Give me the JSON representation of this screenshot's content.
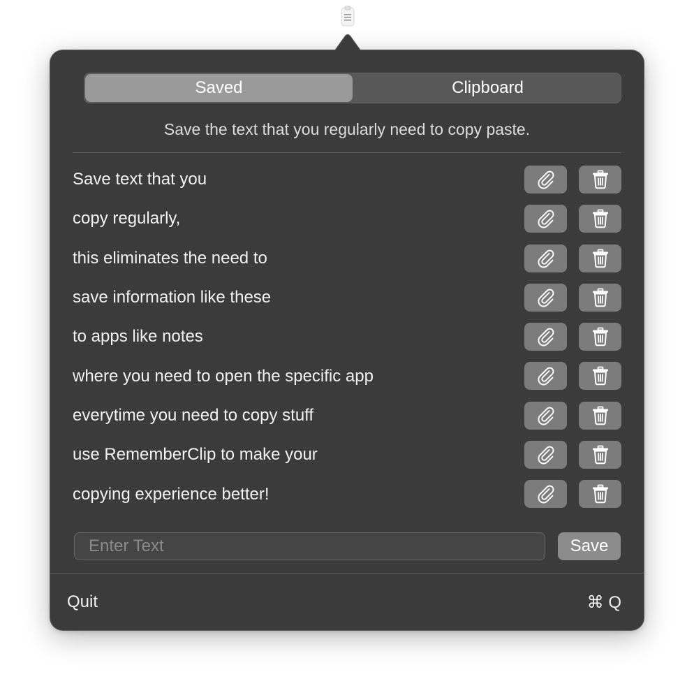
{
  "menubar": {
    "icon": "clipboard-icon"
  },
  "tabs": [
    {
      "label": "Saved",
      "active": true
    },
    {
      "label": "Clipboard",
      "active": false
    }
  ],
  "subtitle": "Save the text that you regularly need to copy paste.",
  "items": [
    {
      "text": "Save text that you"
    },
    {
      "text": "copy regularly,"
    },
    {
      "text": "this eliminates the need to"
    },
    {
      "text": "save information like these"
    },
    {
      "text": "to apps like notes"
    },
    {
      "text": "where you need to open the specific app"
    },
    {
      "text": "everytime you need to copy stuff"
    },
    {
      "text": "use RememberClip to make your"
    },
    {
      "text": "copying experience better!"
    }
  ],
  "row_actions": {
    "copy_icon": "paperclip-icon",
    "delete_icon": "trash-icon"
  },
  "input": {
    "placeholder": "Enter Text",
    "value": ""
  },
  "save_label": "Save",
  "footer": {
    "quit_label": "Quit",
    "shortcut": "⌘ Q"
  },
  "colors": {
    "popover_bg": "#3b3b3b",
    "button_bg": "#7c7c7c",
    "active_tab": "#9a9a9a"
  }
}
